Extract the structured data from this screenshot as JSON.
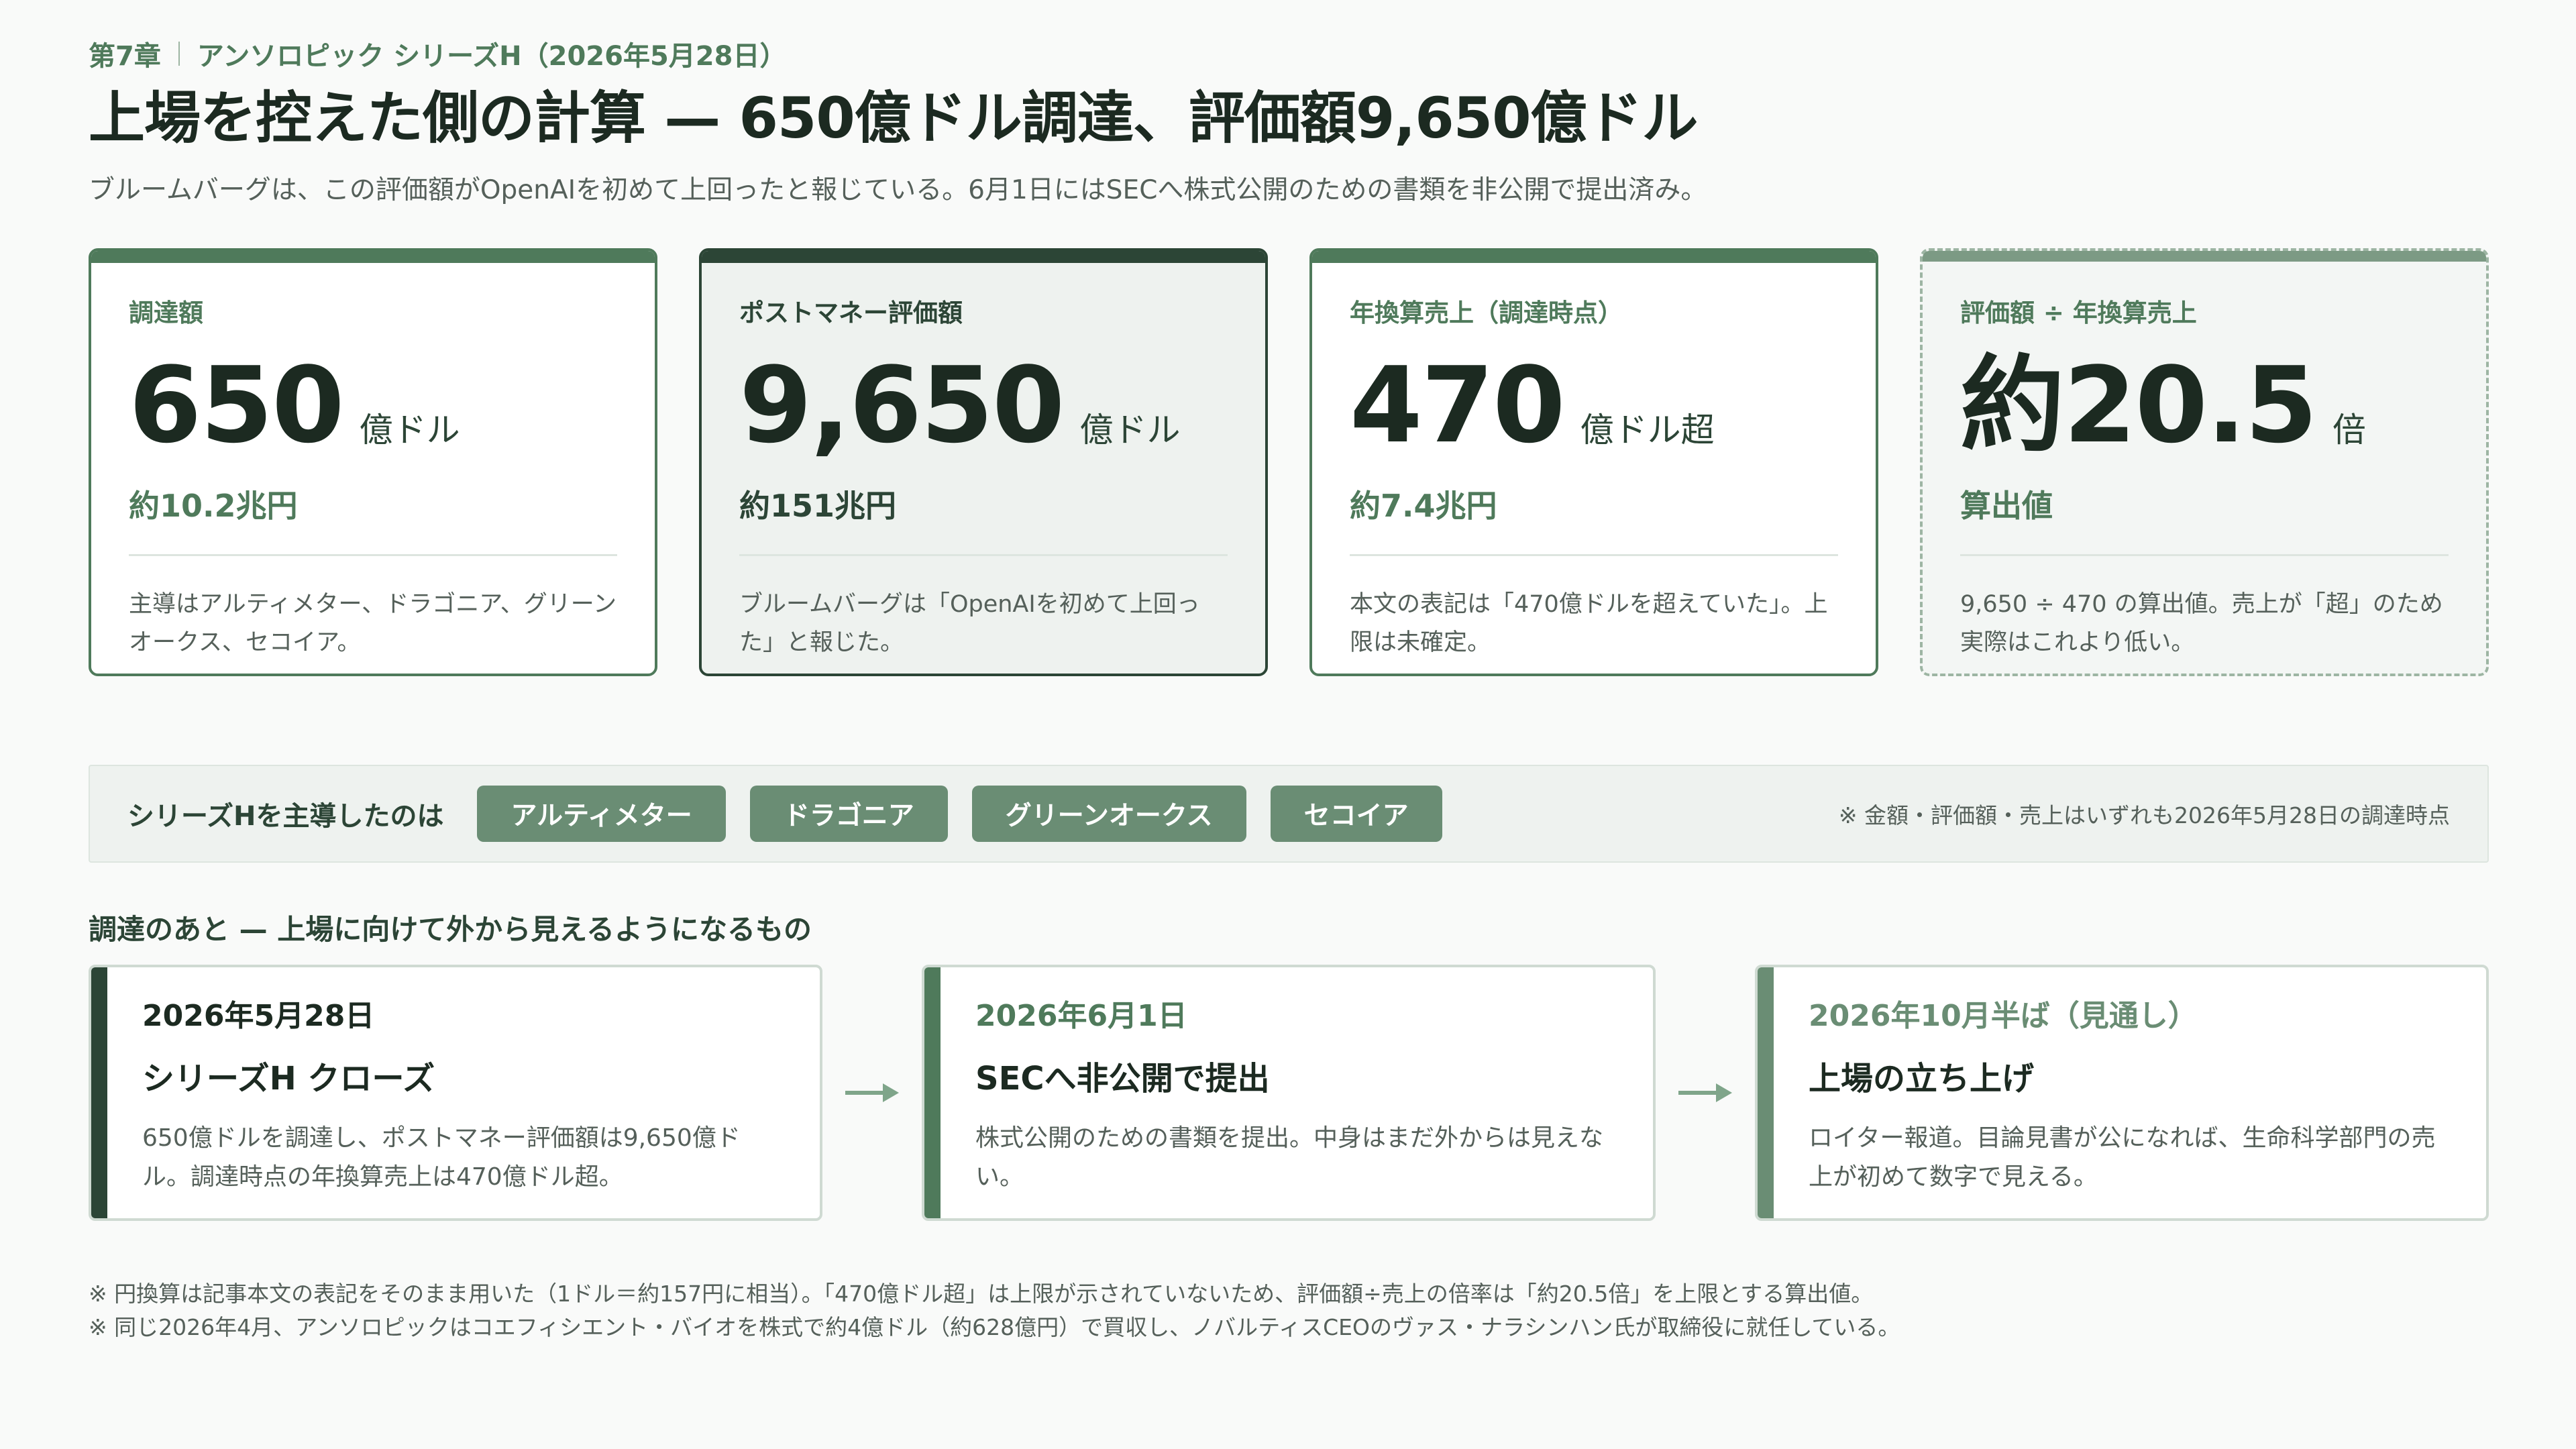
{
  "header": {
    "chapter": "第7章",
    "section": "アンソロピック シリーズH（2026年5月28日）",
    "title": "上場を控えた側の計算 — 650億ドル調達、評価額9,650億ドル",
    "lede": "ブルームバーグは、この評価額がOpenAIを初めて上回ったと報じている。6月1日にはSECへ株式公開のための書類を非公開で提出済み。"
  },
  "cards": [
    {
      "label": "調達額",
      "value": "650",
      "unit": "億ドル",
      "sub": "約10.2兆円",
      "note": "主導はアルティメター、ドラゴニア、グリーンオークス、セコイア。"
    },
    {
      "label": "ポストマネー評価額",
      "value": "9,650",
      "unit": "億ドル",
      "sub": "約151兆円",
      "note": "ブルームバーグは「OpenAIを初めて上回った」と報じた。"
    },
    {
      "label": "年換算売上（調達時点）",
      "value": "470",
      "unit": "億ドル超",
      "sub": "約7.4兆円",
      "note": "本文の表記は「470億ドルを超えていた」。上限は未確定。"
    },
    {
      "label": "評価額 ÷ 年換算売上",
      "value": "約20.5",
      "unit": "倍",
      "sub": "算出値",
      "note": "9,650 ÷ 470 の算出値。売上が「超」のため実際はこれより低い。"
    }
  ],
  "leads": {
    "label": "シリーズHを主導したのは",
    "investors": [
      "アルティメター",
      "ドラゴニア",
      "グリーンオークス",
      "セコイア"
    ],
    "as_of": "※ 金額・評価額・売上はいずれも2026年5月28日の調達時点"
  },
  "timeline": {
    "heading": "調達のあと — 上場に向けて外から見えるようになるもの",
    "events": [
      {
        "date": "2026年5月28日",
        "title": "シリーズH クローズ",
        "desc": "650億ドルを調達し、ポストマネー評価額は9,650億ドル。調達時点の年換算売上は470億ドル超。"
      },
      {
        "date": "2026年6月1日",
        "title": "SECへ非公開で提出",
        "desc": "株式公開のための書類を提出。中身はまだ外からは見えない。"
      },
      {
        "date": "2026年10月半ば（見通し）",
        "title": "上場の立ち上げ",
        "desc": "ロイター報道。目論見書が公になれば、生命科学部門の売上が初めて数字で見える。"
      }
    ]
  },
  "footnotes": [
    "※ 円換算は記事本文の表記をそのまま用いた（1ドル＝約157円に相当）。「470億ドル超」は上限が示されていないため、評価額÷売上の倍率は「約20.5倍」を上限とする算出値。",
    "※ 同じ2026年4月、アンソロピックはコエフィシエント・バイオを株式で約4億ドル（約628億円）で買収し、ノバルティスCEOのヴァス・ナラシンハン氏が取締役に就任している。"
  ],
  "colors": {
    "accent": "#4f7a5b",
    "dark": "#2c4536",
    "chip": "#6a8d74",
    "text": "#1c2a21"
  }
}
